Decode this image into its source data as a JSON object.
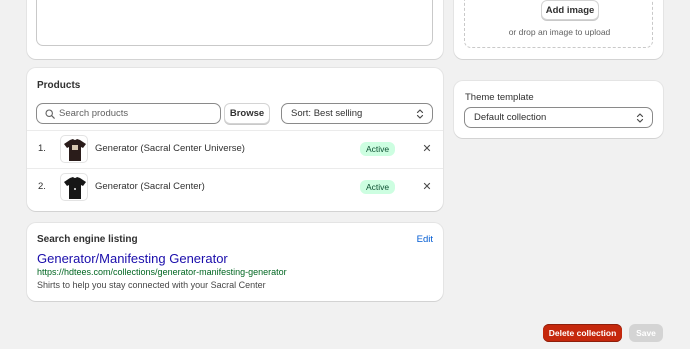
{
  "image": {
    "add_button": "Add image",
    "drop_hint": "or drop an image to upload"
  },
  "theme": {
    "label": "Theme template",
    "selected": "Default collection"
  },
  "products": {
    "title": "Products",
    "search_placeholder": "Search products",
    "browse_label": "Browse",
    "sort_label": "Sort: Best selling",
    "items": [
      {
        "num": "1.",
        "name": "Generator (Sacral Center Universe)",
        "status": "Active",
        "shirt_color": "#2a1c1a"
      },
      {
        "num": "2.",
        "name": "Generator (Sacral Center)",
        "status": "Active",
        "shirt_color": "#161616"
      }
    ]
  },
  "seo": {
    "title": "Search engine listing",
    "edit_label": "Edit",
    "page_title": "Generator/Manifesting Generator",
    "url": "https://hdtees.com/collections/generator-manifesting-generator",
    "description": "Shirts to help you stay connected with your Sacral Center"
  },
  "actions": {
    "delete_label": "Delete collection",
    "save_label": "Save"
  },
  "colors": {
    "accent_link": "#005bd3",
    "danger": "#c5280c",
    "success_bg": "#cdfee1"
  }
}
